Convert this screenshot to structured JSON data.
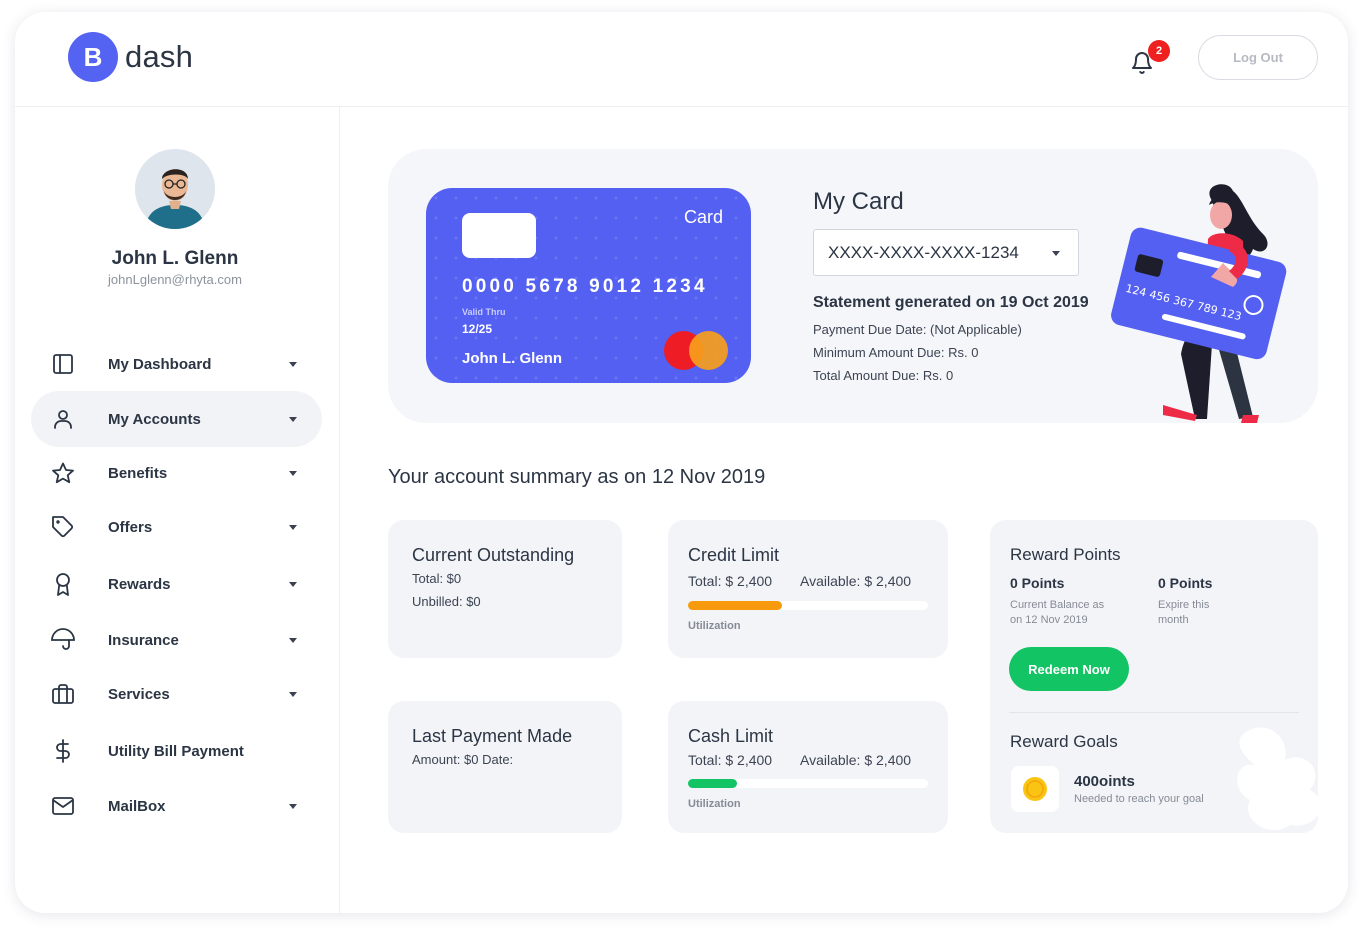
{
  "brand": {
    "badge": "B",
    "name": "dash"
  },
  "header": {
    "notifications": "2",
    "logout_label": "Log Out"
  },
  "user": {
    "name": "John L. Glenn",
    "email": "johnLglenn@rhyta.com"
  },
  "nav": [
    {
      "label": "My Dashboard",
      "icon": "sidebar-layout-icon",
      "has_caret": true,
      "active": false
    },
    {
      "label": "My Accounts",
      "icon": "user-icon",
      "has_caret": true,
      "active": true
    },
    {
      "label": "Benefits",
      "icon": "star-icon",
      "has_caret": true,
      "active": false
    },
    {
      "label": "Offers",
      "icon": "tag-icon",
      "has_caret": true,
      "active": false
    },
    {
      "label": "Rewards",
      "icon": "award-icon",
      "has_caret": true,
      "active": false
    },
    {
      "label": "Insurance",
      "icon": "umbrella-icon",
      "has_caret": true,
      "active": false
    },
    {
      "label": "Services",
      "icon": "briefcase-icon",
      "has_caret": true,
      "active": false
    },
    {
      "label": "Utility Bill Payment",
      "icon": "dollar-icon",
      "has_caret": false,
      "active": false
    },
    {
      "label": "MailBox",
      "icon": "mail-icon",
      "has_caret": true,
      "active": false
    }
  ],
  "card": {
    "label": "Card",
    "number": "0000 5678 9012 1234",
    "valid_label": "Valid Thru",
    "valid_date": "12/25",
    "holder": "John L. Glenn",
    "color": "#5460f1"
  },
  "my_card": {
    "title": "My Card",
    "selected": "XXXX-XXXX-XXXX-1234",
    "statement": "Statement generated on 19 Oct 2019",
    "payment_due": "Payment Due Date: (Not Applicable)",
    "minimum_due": "Minimum Amount Due: Rs. 0",
    "total_due": "Total Amount Due: Rs. 0"
  },
  "illustration": {
    "card_number": "124 456 367 789 123"
  },
  "summary": {
    "title": "Your account summary as on 12 Nov 2019",
    "outstanding": {
      "title": "Current Outstanding",
      "total": "Total: $0",
      "unbilled": "Unbilled: $0"
    },
    "last_payment": {
      "title": "Last Payment Made",
      "detail": "Amount: $0 Date:"
    },
    "credit_limit": {
      "title": "Credit Limit",
      "total": "Total: $ 2,400",
      "available": "Available: $ 2,400",
      "util_label": "Utilization",
      "utilization": 0.39,
      "color": "#f79a0e"
    },
    "cash_limit": {
      "title": "Cash Limit",
      "total": "Total: $ 2,400",
      "available": "Available: $ 2,400",
      "util_label": "Utilization",
      "utilization": 0.205,
      "color": "#12c463"
    },
    "rewards": {
      "title": "Reward Points",
      "current_points": "0 Points",
      "current_note_1": "Current Balance as",
      "current_note_2": "on 12 Nov 2019",
      "expire_points": "0 Points",
      "expire_note_1": "Expire this",
      "expire_note_2": "month",
      "redeem_label": "Redeem Now",
      "goals_title": "Reward Goals",
      "goal_value": "400oints",
      "goal_note": "Needed to reach your goal"
    }
  }
}
